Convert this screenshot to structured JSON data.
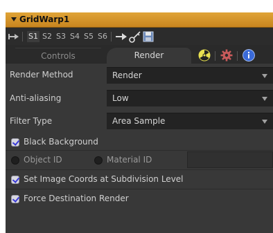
{
  "panel": {
    "title": "GridWarp1",
    "header_color": "#d59526"
  },
  "toolbar": {
    "slots": [
      "S1",
      "S2",
      "S3",
      "S4",
      "S5",
      "S6"
    ],
    "active_slot": "S1"
  },
  "tabs": {
    "controls_label": "Controls",
    "render_label": "Render",
    "active": "Render",
    "icons": [
      "radioactive-icon",
      "gear-icon",
      "info-icon"
    ]
  },
  "render": {
    "render_method_label": "Render Method",
    "render_method_value": "Render",
    "anti_aliasing_label": "Anti-aliasing",
    "anti_aliasing_value": "Low",
    "filter_type_label": "Filter Type",
    "filter_type_value": "Area Sample",
    "black_background_label": "Black Background",
    "black_background_checked": true,
    "object_id_label": "Object ID",
    "object_id_checked": false,
    "material_id_label": "Material ID",
    "material_id_checked": false,
    "set_image_coords_label": "Set Image Coords at Subdivision Level",
    "set_image_coords_checked": true,
    "force_destination_label": "Force Destination Render",
    "force_destination_checked": true
  }
}
